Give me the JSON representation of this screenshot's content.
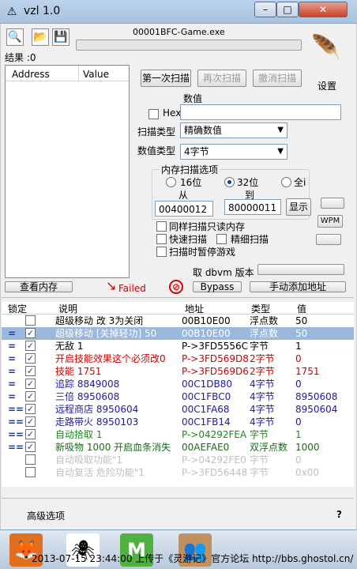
{
  "window": {
    "title": "vzl 1.0",
    "minimize": "–",
    "maximize": "□",
    "close": "✕"
  },
  "toolbar": {
    "process_name": "00001BFC-Game.exe",
    "results_label": "结果 :0"
  },
  "found_list": {
    "col_address": "Address",
    "col_value": "Value"
  },
  "scan": {
    "first_scan": "第一次扫描",
    "next_scan": "再次扫描",
    "undo_scan": "撤消扫描",
    "settings": "设置",
    "value_label": "数值",
    "hex_label": "Hex",
    "scan_type_label": "扫描类型",
    "scan_type_value": "精确数值",
    "value_type_label": "数值类型",
    "value_type_value": "4字节",
    "memory_options_title": "内存扫描选项",
    "bits16": "16位",
    "bits32": "32位",
    "all": "全i",
    "from_label": "从",
    "to_label": "到",
    "from_value": "00400012",
    "to_value": "80000011",
    "show_button": "显示",
    "wpm_button": "WPM",
    "same_readonly": "同样扫描只读内存",
    "fast_scan": "快速扫描",
    "fine_scan": "精细扫描",
    "pause_game": "扫描时暂停游戏",
    "dbvm_label": "取 dbvm 版本"
  },
  "actions": {
    "view_memory": "查看内存",
    "failed": "Failed",
    "bypass": "Bypass",
    "manual_add": "手动添加地址"
  },
  "table": {
    "headers": {
      "lock": "锁定",
      "desc": "说明",
      "address": "地址",
      "type": "类型",
      "value": "值"
    },
    "rows": [
      {
        "mark": "",
        "checked": false,
        "desc": "超级移动 改 3为关闭",
        "address": "00B10E00",
        "type": "浮点数",
        "value": "50",
        "color": "#000000",
        "selected": false
      },
      {
        "mark": "=",
        "checked": true,
        "desc": "超级移动 [关掉轻功] 50",
        "address": "00B10E00",
        "type": "浮点数",
        "value": "50",
        "color": "#ffffff",
        "selected": true
      },
      {
        "mark": "=",
        "checked": true,
        "desc": "无敌  1",
        "address": "P->3FD5556C",
        "type": "字节",
        "value": "1",
        "color": "#000000",
        "selected": false
      },
      {
        "mark": "=",
        "checked": true,
        "desc": "开启技能效果这个必须改0",
        "address": "P->3FD569D8",
        "type": "2字节",
        "value": "0",
        "color": "#cc0000",
        "selected": false
      },
      {
        "mark": "=",
        "checked": true,
        "desc": "技能   1751",
        "address": "P->3FD569D6",
        "type": "2字节",
        "value": "1751",
        "color": "#cc0000",
        "selected": false
      },
      {
        "mark": "=",
        "checked": true,
        "desc": "追踪   8849008",
        "address": "00C1DB80",
        "type": "4字节",
        "value": "0",
        "color": "#1a1aa6",
        "selected": false
      },
      {
        "mark": "=",
        "checked": true,
        "desc": "三倍 8950608",
        "address": "00C1FBC0",
        "type": "4字节",
        "value": "8950608",
        "color": "#1a1aa6",
        "selected": false
      },
      {
        "mark": "==",
        "checked": true,
        "desc": "远程商店 8950604",
        "address": "00C1FA68",
        "type": "4字节",
        "value": "8950604",
        "color": "#1a1aa6",
        "selected": false
      },
      {
        "mark": "==",
        "checked": true,
        "desc": "走路带火 8950103",
        "address": "00C1FB14",
        "type": "4字节",
        "value": "0",
        "color": "#1a1aa6",
        "selected": false
      },
      {
        "mark": "==",
        "checked": true,
        "desc": "自动拾取  1",
        "address": "P->04292FEA",
        "type": "字节",
        "value": "1",
        "color": "#1a8a1a",
        "selected": false
      },
      {
        "mark": "==",
        "checked": true,
        "desc": "新吸物 1000 开启血条消失",
        "address": "00AEFAE0",
        "type": "双浮点数",
        "value": "1000",
        "color": "#1a6a1a",
        "selected": false
      },
      {
        "mark": "",
        "checked": false,
        "desc": "自动吸取功能\"1",
        "address": "P->04292FE0",
        "type": "字节",
        "value": "0",
        "color": "#bfbfbf",
        "selected": false
      },
      {
        "mark": "",
        "checked": false,
        "desc": "自动复活 危险功能\"1",
        "address": "P->3FD56448",
        "type": "字节",
        "value": "0x00",
        "color": "#bfbfbf",
        "selected": false
      }
    ]
  },
  "footer": {
    "advanced": "高级选项",
    "help": "?"
  },
  "taskbar": {
    "watermark": "2013-07-15 23:44:00 上传于《灵游记》官方论坛 http://bbs.ghostol.cn/"
  }
}
